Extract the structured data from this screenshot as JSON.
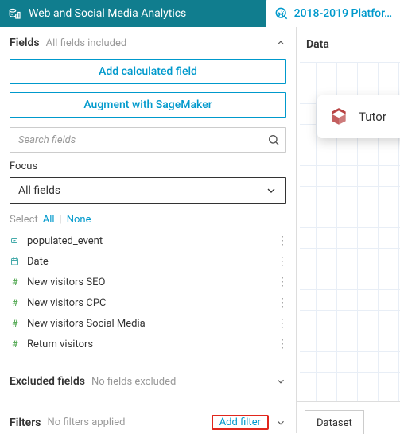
{
  "topbar": {
    "title": "Web and Social Media Analytics",
    "platform_label": "2018-2019 Platfor…"
  },
  "fields_section": {
    "title": "Fields",
    "subtitle": "All fields included",
    "add_calculated": "Add calculated field",
    "augment": "Augment with SageMaker",
    "search_placeholder": "Search fields",
    "focus_label": "Focus",
    "focus_value": "All fields",
    "select_label": "Select",
    "select_all": "All",
    "select_none": "None",
    "items": [
      {
        "icon": "string",
        "name": "populated_event"
      },
      {
        "icon": "date",
        "name": "Date"
      },
      {
        "icon": "hash",
        "name": "New visitors SEO"
      },
      {
        "icon": "hash",
        "name": "New visitors CPC"
      },
      {
        "icon": "hash",
        "name": "New visitors Social Media"
      },
      {
        "icon": "hash",
        "name": "Return visitors"
      }
    ]
  },
  "excluded_section": {
    "title": "Excluded fields",
    "subtitle": "No fields excluded"
  },
  "filters_section": {
    "title": "Filters",
    "subtitle": "No filters applied",
    "add_filter": "Add filter"
  },
  "right": {
    "data_label": "Data",
    "card_text": "Tutor",
    "tab_dataset": "Dataset"
  }
}
